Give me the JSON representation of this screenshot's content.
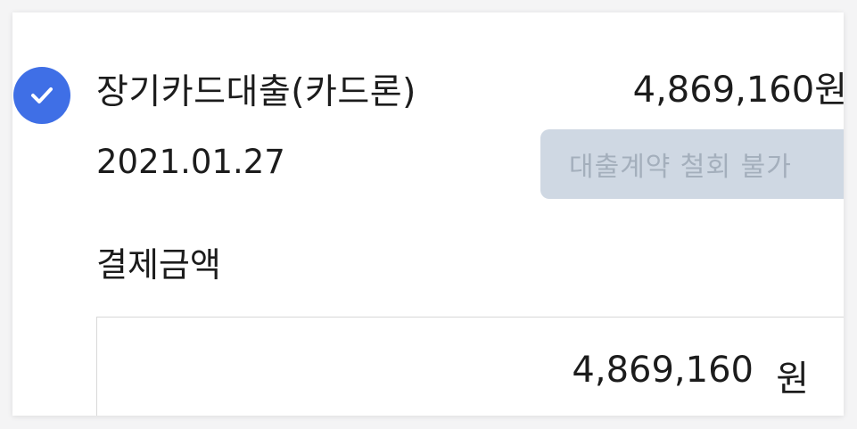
{
  "loan": {
    "title": "장기카드대출(카드론)",
    "amount": "4,869,160원",
    "date": "2021.01.27",
    "withdraw_status": "대출계약 철회 불가",
    "selected": true
  },
  "payment": {
    "label": "결제금액",
    "value": "4,869,160",
    "unit": "원"
  },
  "colors": {
    "accent": "#3f6fe6",
    "badge_bg": "#cfd8e3",
    "badge_text": "#a4afbc",
    "text": "#1c1c1c"
  },
  "icons": {
    "selection": "check-circle-icon"
  }
}
